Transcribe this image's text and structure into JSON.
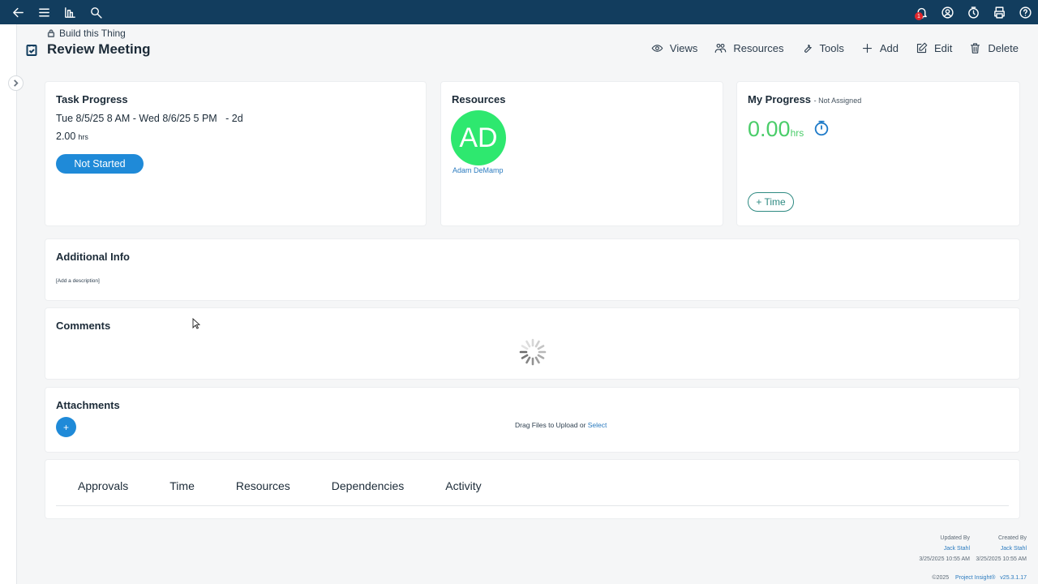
{
  "header": {
    "breadcrumb": "Build this Thing",
    "title": "Review Meeting",
    "actions": {
      "views": "Views",
      "resources": "Resources",
      "tools": "Tools",
      "add": "Add",
      "edit": "Edit",
      "delete": "Delete"
    }
  },
  "topbar": {
    "notification_count": "1"
  },
  "task_progress": {
    "title": "Task Progress",
    "date_range": "Tue 8/5/25 8 AM - Wed 8/6/25 5 PM",
    "duration": "- 2d",
    "hours": "2.00",
    "hours_unit": "hrs",
    "status": "Not Started"
  },
  "resources": {
    "title": "Resources",
    "avatar_initials": "AD",
    "avatar_name": "Adam DeMamp",
    "avatar_color": "#2ee86f"
  },
  "my_progress": {
    "title": "My Progress",
    "subtitle": "- Not Assigned",
    "hours": "0.00",
    "hours_unit": "hrs",
    "add_time": "+ Time"
  },
  "additional_info": {
    "title": "Additional Info",
    "placeholder": "[Add a description]"
  },
  "comments": {
    "title": "Comments"
  },
  "attachments": {
    "title": "Attachments",
    "add_label": "+",
    "drag_text": "Drag Files to Upload or ",
    "select_link": "Select"
  },
  "tabs": [
    "Approvals",
    "Time",
    "Resources",
    "Dependencies",
    "Activity"
  ],
  "footer": {
    "updated_by_label": "Updated By",
    "updated_by": "Jack Stahl",
    "updated_at": "3/25/2025 10:55 AM",
    "created_by_label": "Created By",
    "created_by": "Jack Stahl",
    "created_at": "3/25/2025 10:55 AM",
    "copyright": "©2025",
    "product": "Project Insight®",
    "version": "v25.3.1.17"
  },
  "colors": {
    "topbar": "#123d5e",
    "primary": "#1f8ad8",
    "success": "#4bcd6a",
    "link": "#2b7bbf"
  }
}
